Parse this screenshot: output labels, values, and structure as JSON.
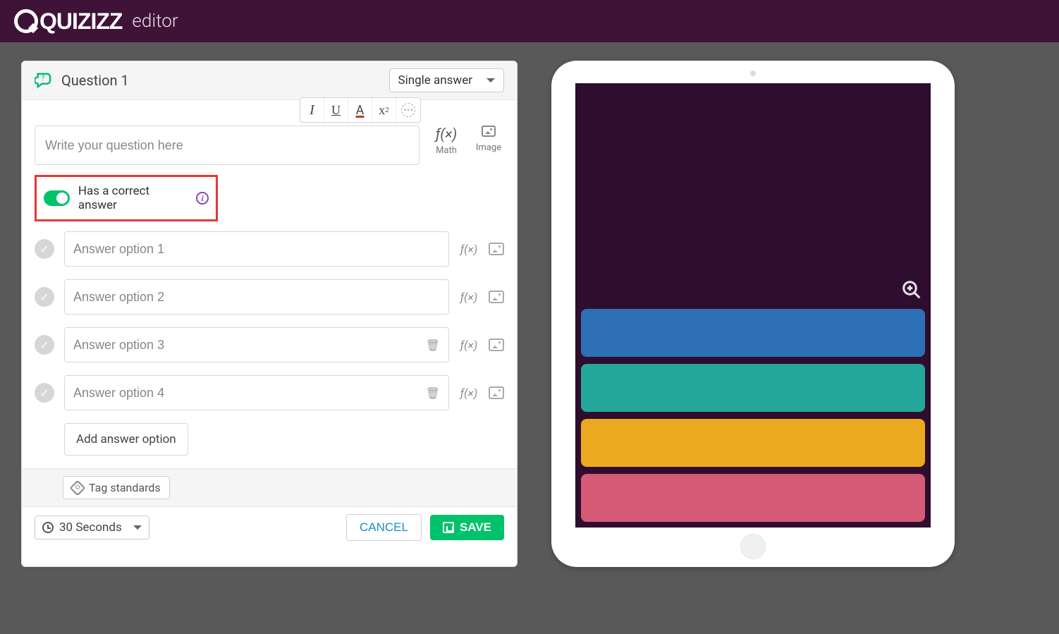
{
  "header": {
    "brand": "Quizizz",
    "app_label": "editor"
  },
  "question": {
    "title": "Question 1",
    "answer_type": "Single answer",
    "placeholder": "Write your question here",
    "tools": {
      "math": "Math",
      "image": "Image",
      "fx": "ƒ(×)"
    }
  },
  "toggle": {
    "label": "Has a correct answer",
    "on": true
  },
  "answers": [
    {
      "placeholder": "Answer option 1",
      "deletable": false
    },
    {
      "placeholder": "Answer option 2",
      "deletable": false
    },
    {
      "placeholder": "Answer option 3",
      "deletable": true
    },
    {
      "placeholder": "Answer option 4",
      "deletable": true
    }
  ],
  "add_option_label": "Add answer option",
  "tag_standards_label": "Tag standards",
  "footer": {
    "time": "30 Seconds",
    "cancel": "CANCEL",
    "save": "SAVE"
  },
  "fx_glyph": "ƒ(×)",
  "preview": {
    "option_colors": [
      "#2d70b6",
      "#24a79b",
      "#eaa91f",
      "#d55a76"
    ]
  }
}
